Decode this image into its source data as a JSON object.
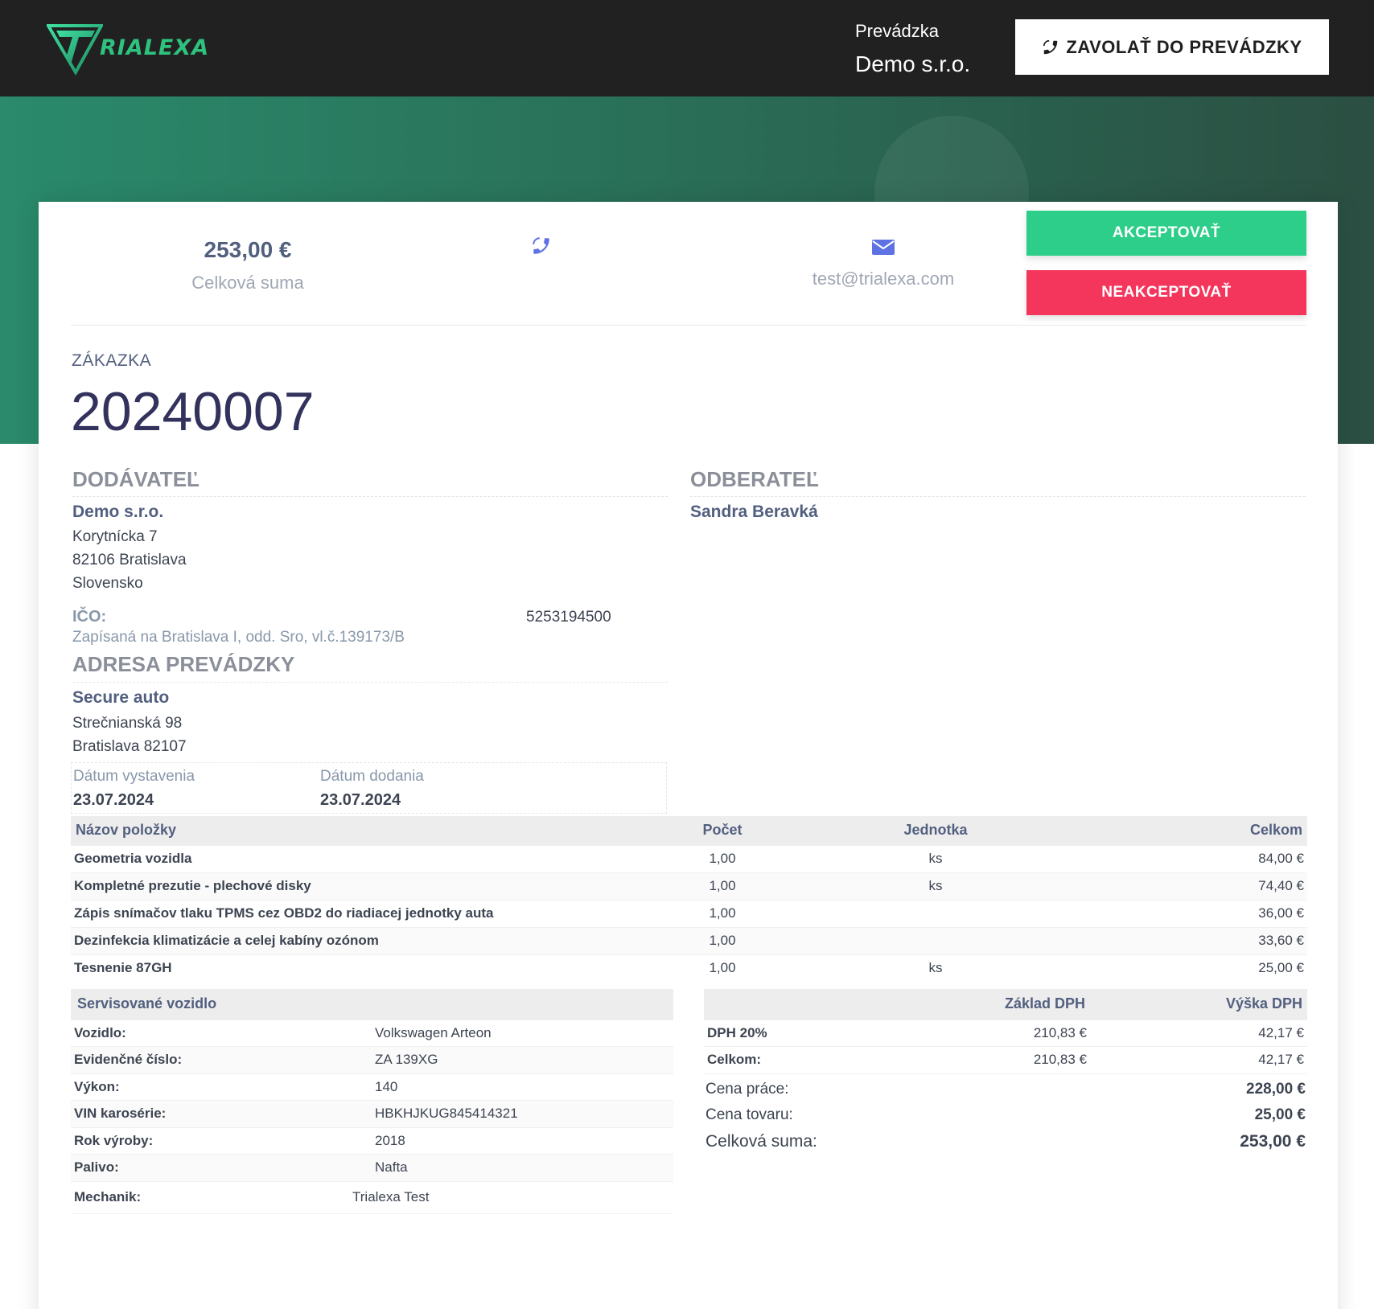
{
  "header": {
    "logo_text": "RIALEXA",
    "shop_label": "Prevádzka",
    "shop_name": "Demo s.r.o.",
    "call_button": "ZAVOLAŤ DO PREVÁDZKY"
  },
  "summary": {
    "total_value": "253,00 €",
    "total_label": "Celková suma",
    "email": "test@trialexa.com",
    "accept_button": "AKCEPTOVAŤ",
    "reject_button": "NEAKCEPTOVAŤ"
  },
  "order": {
    "label": "ZÁKAZKA",
    "number": "20240007"
  },
  "supplier": {
    "title": "DODÁVATEĽ",
    "name": "Demo s.r.o.",
    "street": "Korytnícka 7",
    "city": "82106 Bratislava",
    "country": "Slovensko",
    "ico_label": "IČO:",
    "ico_value": "5253194500",
    "registration": "Zapísaná na Bratislava I, odd. Sro, vl.č.139173/B"
  },
  "customer": {
    "title": "ODBERATEĽ",
    "name": "Sandra Beravká"
  },
  "shop_address": {
    "title": "ADRESA PREVÁDZKY",
    "name": "Secure auto",
    "street": "Strečnianská 98",
    "city": "Bratislava 82107"
  },
  "dates": {
    "issued_label": "Dátum vystavenia",
    "issued_value": "23.07.2024",
    "delivery_label": "Dátum dodania",
    "delivery_value": "23.07.2024"
  },
  "items": {
    "headers": [
      "Názov položky",
      "Počet",
      "Jednotka",
      "Celkom"
    ],
    "rows": [
      {
        "name": "Geometria vozidla",
        "qty": "1,00",
        "unit": "ks",
        "total": "84,00 €"
      },
      {
        "name": "Kompletné prezutie - plechové disky",
        "qty": "1,00",
        "unit": "ks",
        "total": "74,40 €"
      },
      {
        "name": "Zápis snímačov tlaku TPMS cez OBD2 do riadiacej jednotky auta",
        "qty": "1,00",
        "unit": "",
        "total": "36,00 €"
      },
      {
        "name": "Dezinfekcia klimatizácie a celej kabíny ozónom",
        "qty": "1,00",
        "unit": "",
        "total": "33,60 €"
      },
      {
        "name": "Tesnenie 87GH",
        "qty": "1,00",
        "unit": "ks",
        "total": "25,00 €"
      }
    ]
  },
  "vehicle": {
    "title": "Servisované vozidlo",
    "rows": [
      {
        "key": "Vozidlo:",
        "value": "Volkswagen Arteon"
      },
      {
        "key": "Evidenčné číslo:",
        "value": "ZA 139XG"
      },
      {
        "key": "Výkon:",
        "value": "140"
      },
      {
        "key": "VIN karosérie:",
        "value": "HBKHJKUG845414321"
      },
      {
        "key": "Rok výroby:",
        "value": "2018"
      },
      {
        "key": "Palivo:",
        "value": "Nafta"
      }
    ],
    "mechanic_key": "Mechanik:",
    "mechanic_value": "Trialexa Test"
  },
  "vat": {
    "headers": [
      "",
      "Základ DPH",
      "Výška DPH"
    ],
    "rows": [
      {
        "key": "DPH 20%",
        "base": "210,83 €",
        "amount": "42,17 €"
      },
      {
        "key": "Celkom:",
        "base": "210,83 €",
        "amount": "42,17 €"
      }
    ],
    "labor_label": "Cena práce:",
    "labor_value": "228,00 €",
    "goods_label": "Cena tovaru:",
    "goods_value": "25,00 €",
    "total_label": "Celková suma:",
    "total_value": "253,00 €"
  },
  "colors": {
    "accept": "#2dce89",
    "reject": "#f5365c",
    "topbar": "#212121",
    "hero_start": "#2a8a6b",
    "hero_end": "#2b4f42",
    "icon_accent": "#5e72e4"
  },
  "icons": [
    "trialexa-logo",
    "phone-icon",
    "envelope-icon"
  ]
}
